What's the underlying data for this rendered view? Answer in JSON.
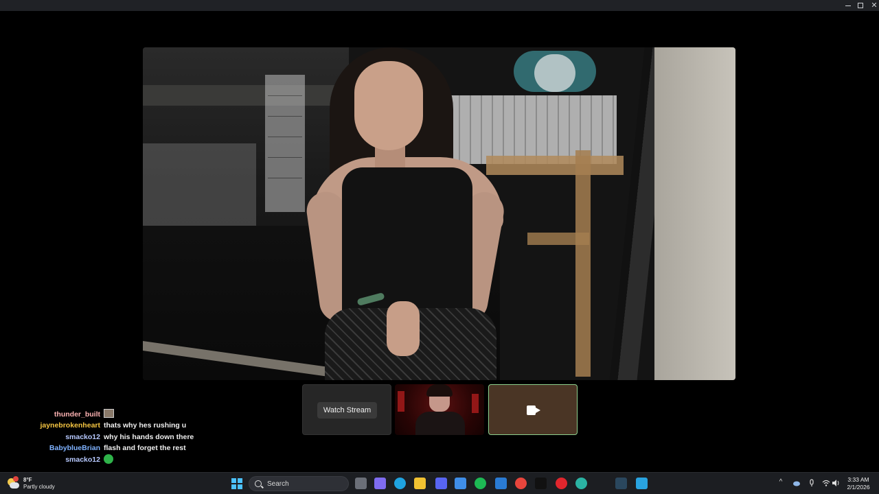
{
  "titlebar": {
    "minimize": "–",
    "close": "✕"
  },
  "stream": {
    "watch_label": "Watch Stream"
  },
  "chat": [
    {
      "user": "thunder_built",
      "user_color": "#ffb3b3",
      "message": "",
      "emote": "face-emote"
    },
    {
      "user": "jaynebrokenheart",
      "user_color": "#f5c542",
      "message": "thats why hes rushing u",
      "emote": ""
    },
    {
      "user": "smacko12",
      "user_color": "#b7c9ff",
      "message": "why his hands down there",
      "emote": ""
    },
    {
      "user": "BabyblueBrian",
      "user_color": "#7fb2ff",
      "message": "flash and forget the rest",
      "emote": ""
    },
    {
      "user": "smacko12",
      "user_color": "#b7c9ff",
      "message": "",
      "emote": "green-emote"
    }
  ],
  "taskbar": {
    "weather_temp": "8°F",
    "weather_desc": "Partly cloudy",
    "search_label": "Search",
    "time": "3:33 AM",
    "date": "2/1/2026",
    "tray_chevron": "^",
    "app_icons": [
      {
        "name": "task-view-icon",
        "color": "#6b6f78"
      },
      {
        "name": "copilot-icon",
        "color": "#7f6cf0"
      },
      {
        "name": "edge-icon",
        "color": "#1fa3e0"
      },
      {
        "name": "file-explorer-icon",
        "color": "#f1c232"
      },
      {
        "name": "discord-icon",
        "color": "#5865f2"
      },
      {
        "name": "store-icon",
        "color": "#3f8ee8"
      },
      {
        "name": "spotify-icon",
        "color": "#1db954"
      },
      {
        "name": "mail-icon",
        "color": "#2a7bd4"
      },
      {
        "name": "chrome-icon",
        "color": "#e8453c"
      },
      {
        "name": "tiktok-icon",
        "color": "#111111"
      },
      {
        "name": "opera-icon",
        "color": "#e0262d"
      },
      {
        "name": "globe-app-icon",
        "color": "#2bb3a3"
      },
      {
        "name": "steam-icon",
        "color": "#2a475e"
      },
      {
        "name": "f-app-icon",
        "color": "#29a3e0"
      }
    ]
  }
}
